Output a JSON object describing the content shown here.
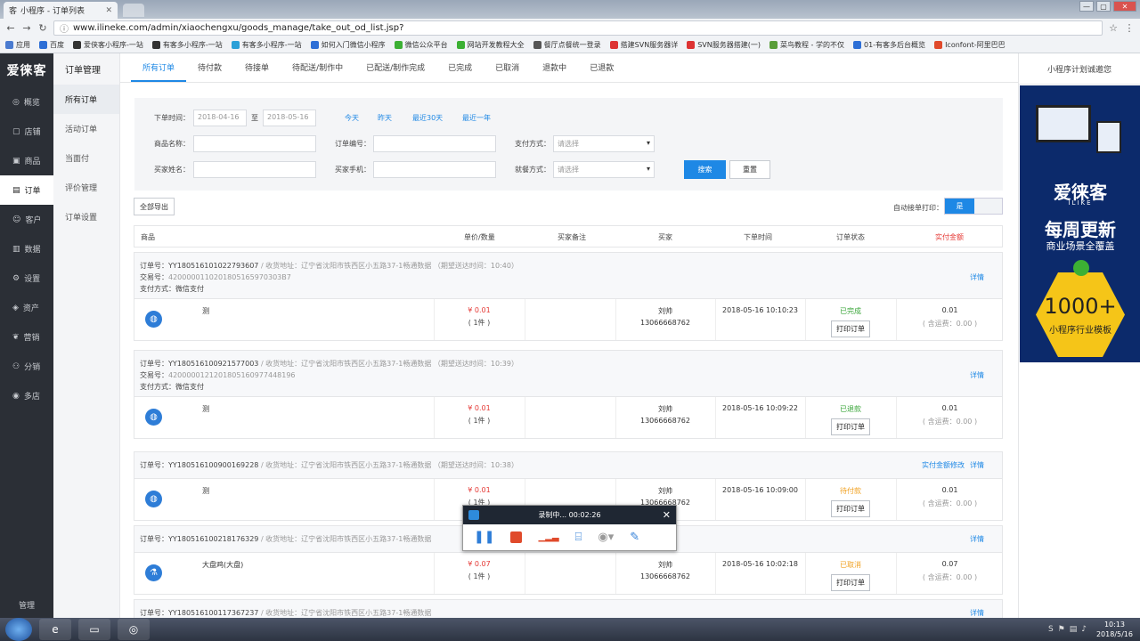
{
  "browser": {
    "tab_title": "小程序 - 订单列表",
    "url": "www.ilineke.com/admin/xiaochengxu/goods_manage/take_out_od_list.jsp?"
  },
  "bookmarks": [
    {
      "label": "应用",
      "color": "#4a7bd0"
    },
    {
      "label": "百度",
      "color": "#2d6fd6"
    },
    {
      "label": "爱侠客小程序-一站",
      "color": "#333"
    },
    {
      "label": "有客多小程序-一站",
      "color": "#333"
    },
    {
      "label": "有客多小程序-一站",
      "color": "#2aa0d8"
    },
    {
      "label": "如何入门微信小程序",
      "color": "#2d6fd6"
    },
    {
      "label": "微信公众平台",
      "color": "#3cb034"
    },
    {
      "label": "网站开发教程大全",
      "color": "#3cb034"
    },
    {
      "label": "餐厅点餐统一登录",
      "color": "#555"
    },
    {
      "label": "搭建SVN服务器详",
      "color": "#d33"
    },
    {
      "label": "SVN服务器搭建(一)",
      "color": "#d33"
    },
    {
      "label": "菜鸟教程 - 学的不仅",
      "color": "#5a9e3a"
    },
    {
      "label": "01-有客多后台概览",
      "color": "#2d6fd6"
    },
    {
      "label": "Iconfont-阿里巴巴",
      "color": "#e04a2b"
    }
  ],
  "sidebar": {
    "logo": "爱徕客",
    "items": [
      {
        "label": "概览",
        "icon": "◎"
      },
      {
        "label": "店铺",
        "icon": "▢"
      },
      {
        "label": "商品",
        "icon": "▣"
      },
      {
        "label": "订单",
        "icon": "▤"
      },
      {
        "label": "客户",
        "icon": "☺"
      },
      {
        "label": "数据",
        "icon": "▥"
      },
      {
        "label": "设置",
        "icon": "⚙"
      },
      {
        "label": "资产",
        "icon": "◈"
      },
      {
        "label": "营销",
        "icon": "❦"
      },
      {
        "label": "分销",
        "icon": "⚇"
      },
      {
        "label": "多店",
        "icon": "◉"
      }
    ],
    "bottom": "管理"
  },
  "subnav": {
    "title": "订单管理",
    "items": [
      "所有订单",
      "活动订单",
      "当面付",
      "评价管理",
      "订单设置"
    ]
  },
  "tabs": [
    "所有订单",
    "待付款",
    "待接单",
    "待配送/制作中",
    "已配送/制作完成",
    "已完成",
    "已取消",
    "退款中",
    "已退款"
  ],
  "filter": {
    "order_time_label": "下单时间：",
    "date_from": "2018-04-16",
    "date_sep": "至",
    "date_to": "2018-05-16",
    "quick": [
      "今天",
      "昨天",
      "最近30天",
      "最近一年"
    ],
    "goods_name_label": "商品名称：",
    "order_no_label": "订单编号：",
    "pay_label": "支付方式：",
    "pay_value": "请选择",
    "buyer_name_label": "买家姓名：",
    "buyer_phone_label": "买家手机：",
    "dining_label": "就餐方式：",
    "dining_value": "请选择",
    "search": "搜索",
    "reset": "重置"
  },
  "export_label": "全部导出",
  "auto_print_label": "自动接单打印：",
  "toggle_on": "是",
  "columns": [
    "商品",
    "单价/数量",
    "买家备注",
    "买家",
    "下单时间",
    "订单状态",
    "实付金额"
  ],
  "orders": [
    {
      "no": "订单号：YY180516101022793607",
      "addr": "/ 收货地址：辽宁省沈阳市铁西区小五路37-1畅通数据",
      "expect": "（期望送达时间：10:40）",
      "trade": "交易号：",
      "trade_no": "4200000110201805165970303B7",
      "pay": "支付方式：微信支付",
      "details": "详情",
      "extra_link": "",
      "goods": "测",
      "price": "¥ 0.01",
      "qty": "( 1件 )",
      "buyer": "刘帅",
      "phone": "13066668762",
      "time": "2018-05-16 10:10:23",
      "status": "已完成",
      "status_color": "#3aa63a",
      "print": "打印订单",
      "amount": "0.01",
      "ship": "( 含运费：0.00 )"
    },
    {
      "no": "订单号：YY180516100921577003",
      "addr": "/ 收货地址：辽宁省沈阳市铁西区小五路37-1畅通数据",
      "expect": "（期望送达时间：10:39）",
      "trade": "交易号：",
      "trade_no": "4200000121201805160977448196",
      "pay": "支付方式：微信支付",
      "details": "详情",
      "extra_link": "",
      "goods": "测",
      "price": "¥ 0.01",
      "qty": "( 1件 )",
      "buyer": "刘帅",
      "phone": "13066668762",
      "time": "2018-05-16 10:09:22",
      "status": "已退款",
      "status_color": "#3aa63a",
      "print": "打印订单",
      "amount": "0.01",
      "ship": "( 含运费：0.00 )"
    },
    {
      "no": "订单号：YY180516100900169228",
      "addr": "/ 收货地址：辽宁省沈阳市铁西区小五路37-1畅通数据",
      "expect": "（期望送达时间：10:38）",
      "trade": "",
      "trade_no": "",
      "pay": "",
      "details": "详情",
      "extra_link": "实付金额修改",
      "goods": "测",
      "price": "¥ 0.01",
      "qty": "( 1件 )",
      "buyer": "刘帅",
      "phone": "13066668762",
      "time": "2018-05-16 10:09:00",
      "status": "待付款",
      "status_color": "#f0a020",
      "print": "打印订单",
      "amount": "0.01",
      "ship": "( 含运费：0.00 )"
    },
    {
      "no": "订单号：YY180516100218176329",
      "addr": "/ 收货地址：辽宁省沈阳市铁西区小五路37-1畅通数据",
      "expect": "",
      "trade": "",
      "trade_no": "",
      "pay": "",
      "details": "详情",
      "extra_link": "",
      "goods": "大盘鸡(大盘)",
      "price": "¥ 0.07",
      "qty": "( 1件 )",
      "buyer": "刘帅",
      "phone": "13066668762",
      "time": "2018-05-16 10:02:18",
      "status": "已取消",
      "status_color": "#f0a020",
      "print": "打印订单",
      "amount": "0.07",
      "ship": "( 含运费：0.00 )"
    },
    {
      "no": "订单号：YY180516100117367237",
      "addr": "/ 收货地址：辽宁省沈阳市铁西区小五路37-1畅通数据",
      "expect": "",
      "details": "详情"
    }
  ],
  "ad": {
    "head": "小程序计划诚邀您",
    "brand": "爱徕客",
    "brand_en": "ILIKE",
    "line1": "每周更新",
    "line2": "商业场景全覆盖",
    "big": "1000+",
    "small": "小程序行业模板"
  },
  "recorder": {
    "status": "录制中... 00:02:26"
  },
  "taskbar": {
    "time": "10:13",
    "date": "2018/5/16"
  }
}
